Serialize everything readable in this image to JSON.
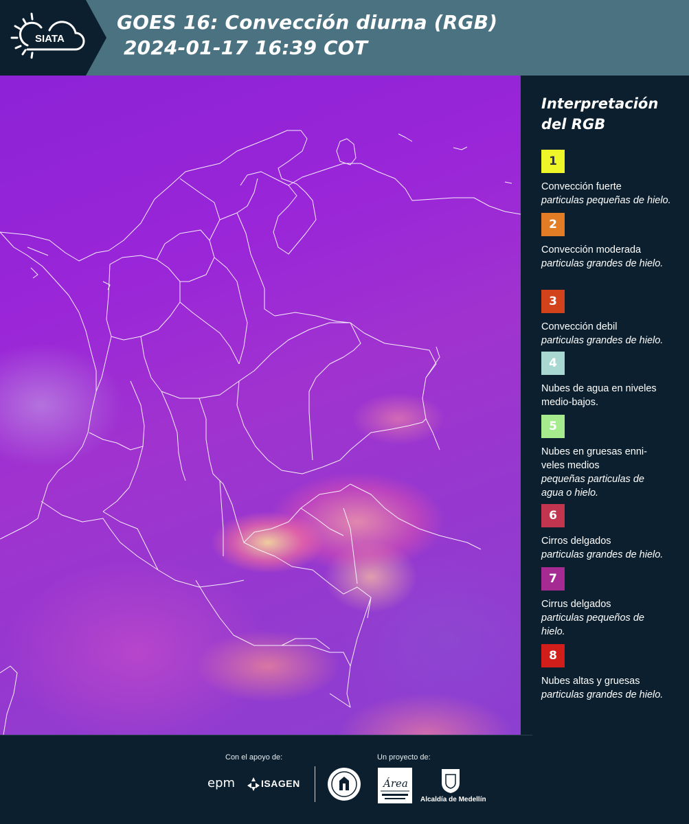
{
  "header": {
    "logo_text": "SIATA",
    "title_line1": "GOES 16: Convección diurna (RGB)",
    "title_line2": " 2024-01-17 16:39 COT",
    "bg_color": "#4a7281"
  },
  "legend": {
    "title_line1": "Interpretación",
    "title_line2": "del RGB",
    "items": [
      {
        "number": "1",
        "color": "#eef629",
        "text_color": "#333333",
        "label": "Convección fuerte",
        "detail": "particulas pequeñas de hielo."
      },
      {
        "number": "2",
        "color": "#e37d25",
        "text_color": "#ffffff",
        "label": "Convección moderada",
        "detail": "particulas grandes de hielo."
      },
      {
        "number": "3",
        "color": "#d2431c",
        "text_color": "#ffffff",
        "label": "Convección debil",
        "detail": "particulas grandes de hielo."
      },
      {
        "number": "4",
        "color": "#a9d7d2",
        "text_color": "#ffffff",
        "label": "Nubes de agua en niveles medio-bajos.",
        "detail": ""
      },
      {
        "number": "5",
        "color": "#a6ec8e",
        "text_color": "#ffffff",
        "label": "Nubes en gruesas enni-veles medios",
        "detail": "pequeñas particulas de agua o hielo."
      },
      {
        "number": "6",
        "color": "#c2354e",
        "text_color": "#ffffff",
        "label": "Cirros delgados",
        "detail": "particulas grandes de hielo."
      },
      {
        "number": "7",
        "color": "#a52b92",
        "text_color": "#ffffff",
        "label": "Cirrus delgados",
        "detail": "particulas pequeños de hielo."
      },
      {
        "number": "8",
        "color": "#d21e1b",
        "text_color": "#ffffff",
        "label": "Nubes altas y gruesas",
        "detail": "particulas grandes de hielo."
      }
    ]
  },
  "footer": {
    "support_label": "Con el apoyo de:",
    "project_label": "Un proyecto de:",
    "epm": "epm",
    "isagen": "ISAGEN",
    "area_metro": "Área",
    "alcaldia": "Alcaldía de Medellín"
  }
}
